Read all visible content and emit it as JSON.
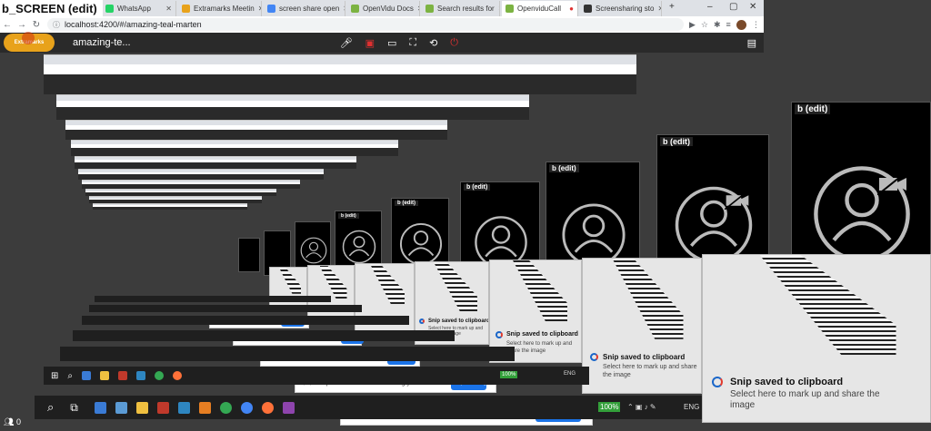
{
  "window_title": "b_SCREEN (edit)",
  "tabs": [
    {
      "label": "WhatsApp",
      "color": "#25d366"
    },
    {
      "label": "Extramarks Meetin",
      "color": "#e8a21b"
    },
    {
      "label": "screen share open",
      "color": "#4285f4"
    },
    {
      "label": "OpenVidu Docs",
      "color": "#7cb342"
    },
    {
      "label": "Search results for",
      "color": "#7cb342"
    },
    {
      "label": "OpenviduCall",
      "color": "#7cb342"
    },
    {
      "label": "Screensharing sto",
      "color": "#333333"
    }
  ],
  "url": "localhost:4200/#/amazing-teal-marten",
  "session_name": "amazing-te...",
  "logo_text": "Extramarks",
  "tile_label": "b (edit)",
  "snip": {
    "title": "Snip saved to clipboard",
    "desc": "Select here to mark up and share the image"
  },
  "share": {
    "message": "http://localhost:4200 is sharing your screen.",
    "stop": "Stop sharing",
    "hide": "Hide"
  },
  "taskbar": {
    "zoom": "100%",
    "lang": "ENG"
  },
  "badge_count": "0",
  "colors": {
    "accent": "#1a73e8",
    "toolbar": "#2a2a2a",
    "danger": "#e03030"
  }
}
